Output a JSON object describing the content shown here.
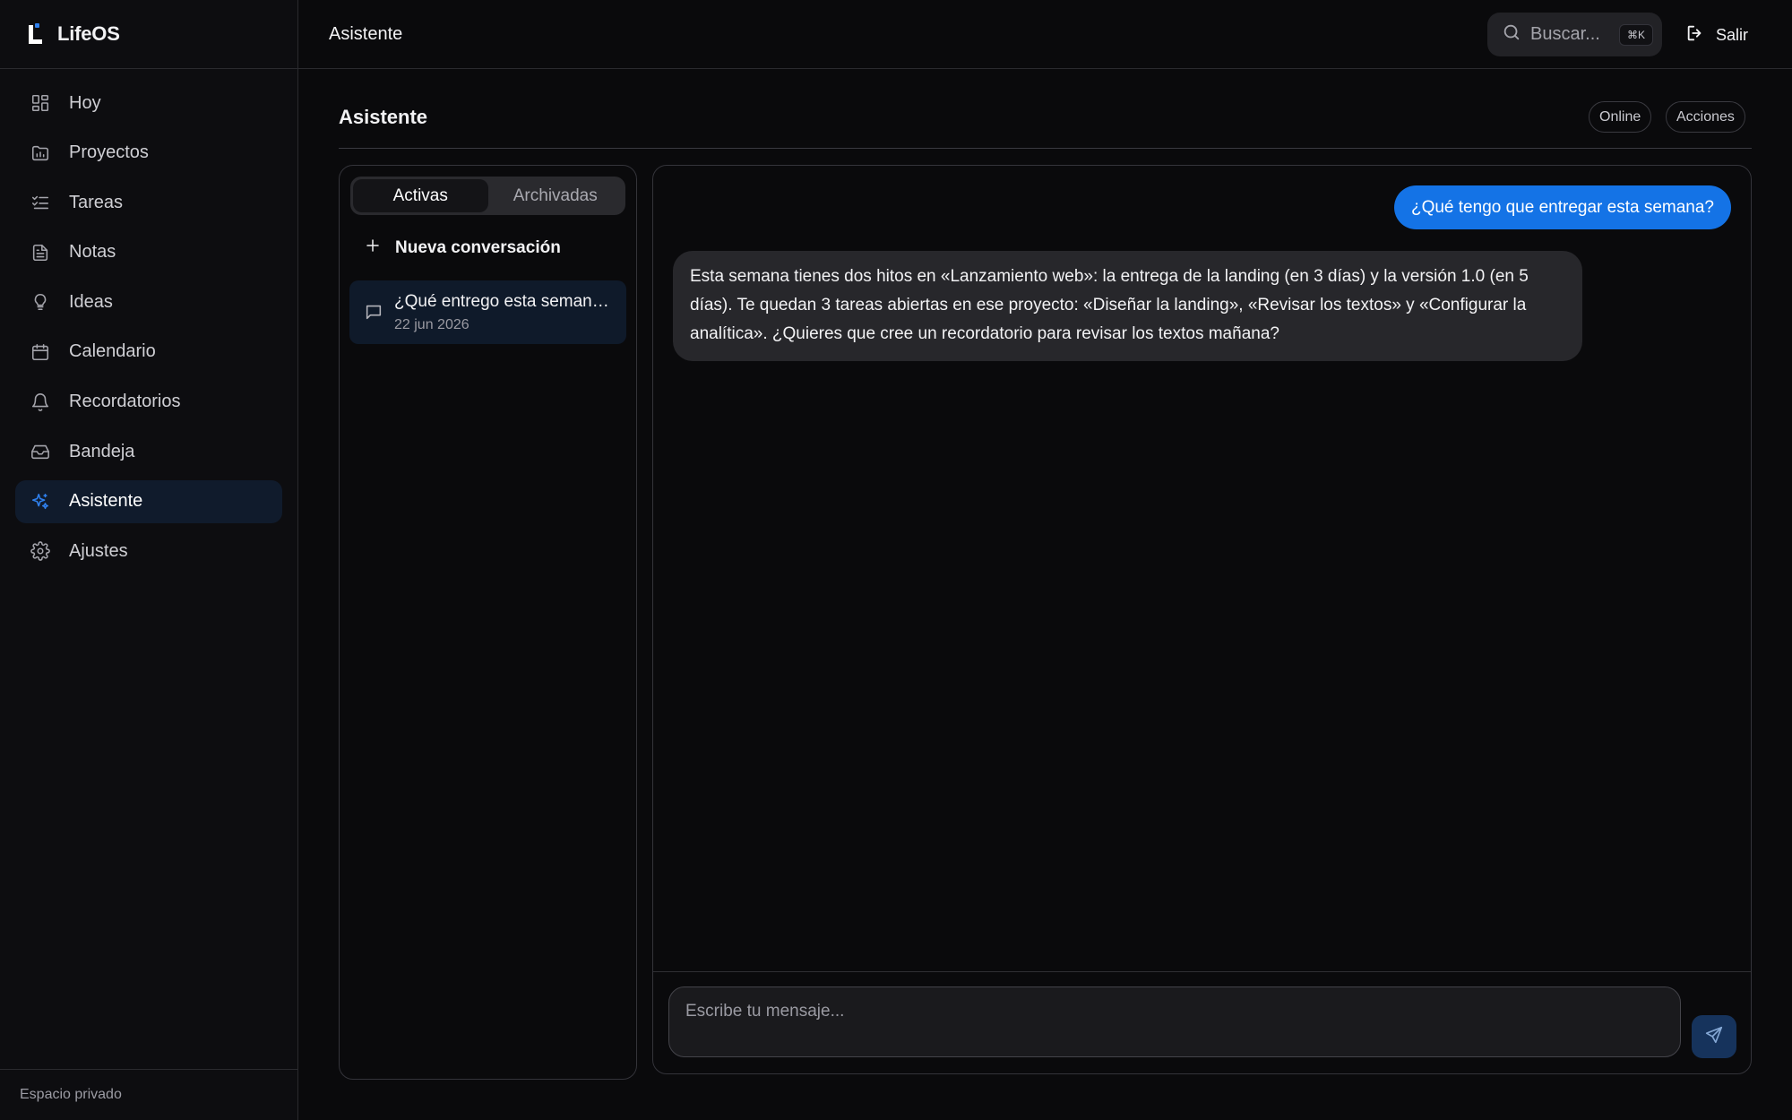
{
  "app": {
    "name": "LifeOS",
    "accent_color": "#1473e6"
  },
  "sidebar": {
    "items": [
      {
        "label": "Hoy",
        "icon": "dashboard-grid-icon"
      },
      {
        "label": "Proyectos",
        "icon": "folder-chart-icon"
      },
      {
        "label": "Tareas",
        "icon": "checklist-icon"
      },
      {
        "label": "Notas",
        "icon": "document-icon"
      },
      {
        "label": "Ideas",
        "icon": "lightbulb-icon"
      },
      {
        "label": "Calendario",
        "icon": "calendar-icon"
      },
      {
        "label": "Recordatorios",
        "icon": "bell-icon"
      },
      {
        "label": "Bandeja",
        "icon": "inbox-icon"
      },
      {
        "label": "Asistente",
        "icon": "sparkles-icon",
        "active": true
      },
      {
        "label": "Ajustes",
        "icon": "gear-icon"
      }
    ],
    "footer": "Espacio privado"
  },
  "topbar": {
    "title": "Asistente",
    "search_placeholder": "Buscar...",
    "search_shortcut": "⌘K",
    "logout_label": "Salir"
  },
  "page": {
    "title": "Asistente",
    "status_badge": "Online",
    "actions_label": "Acciones"
  },
  "conversations": {
    "tabs": [
      {
        "label": "Activas",
        "active": true
      },
      {
        "label": "Archivadas",
        "active": false
      }
    ],
    "new_label": "Nueva conversación",
    "items": [
      {
        "title": "¿Qué entrego esta semana?",
        "date": "22 jun 2026"
      }
    ]
  },
  "chat": {
    "messages": [
      {
        "role": "user",
        "text": "¿Qué tengo que entregar esta semana?"
      },
      {
        "role": "assistant",
        "text": "Esta semana tienes dos hitos en «Lanzamiento web»: la entrega de la landing (en 3 días) y la versión 1.0 (en 5 días). Te quedan 3 tareas abiertas en ese proyecto: «Diseñar la landing», «Revisar los textos» y «Configurar la analítica». ¿Quieres que cree un recordatorio para revisar los textos mañana?"
      }
    ],
    "input_placeholder": "Escribe tu mensaje..."
  }
}
